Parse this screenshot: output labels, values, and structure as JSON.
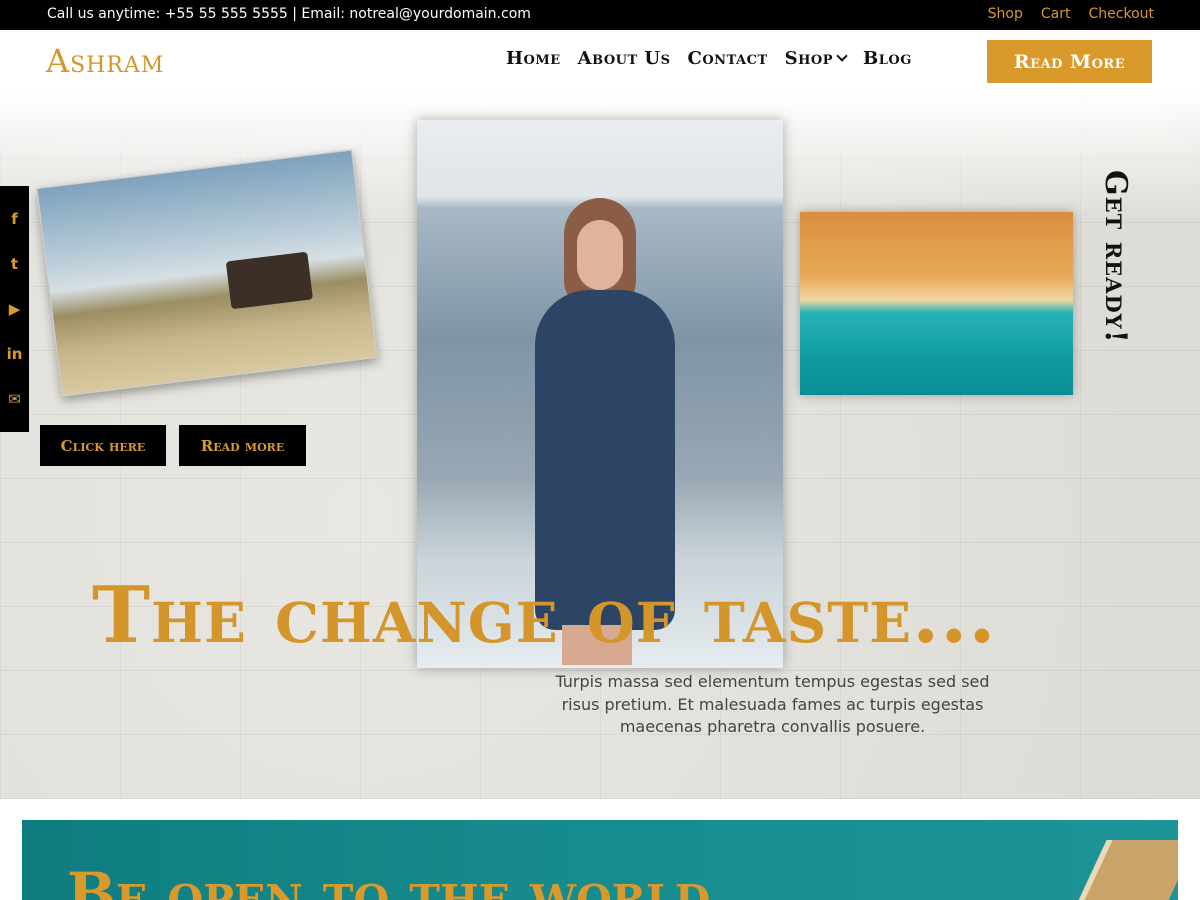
{
  "topbar": {
    "contact": "Call us anytime: +55 55 555 5555 | Email: notreal@yourdomain.com",
    "links": [
      "Shop",
      "Cart",
      "Checkout"
    ]
  },
  "header": {
    "logo": "Ashram",
    "nav": [
      "Home",
      "About Us",
      "Contact",
      "Shop",
      "Blog"
    ],
    "cta": "Read More"
  },
  "social": {
    "icons": [
      "facebook-icon",
      "twitter-icon",
      "youtube-icon",
      "linkedin-icon",
      "envelope-icon"
    ],
    "glyphs": [
      "f",
      "t",
      "▶",
      "in",
      "✉"
    ]
  },
  "hero": {
    "btn_click": "Click here",
    "btn_read": "Read more",
    "side_text": "Get ready!",
    "title": "The change of taste...",
    "text": "Turpis massa sed elementum tempus egestas sed sed risus pretium. Et malesuada fames ac turpis egestas maecenas pharetra convallis posuere."
  },
  "section2": {
    "title": "Be open to the world"
  },
  "colors": {
    "accent": "#d99a2b",
    "dark": "#000000",
    "teal": "#178c8e"
  }
}
